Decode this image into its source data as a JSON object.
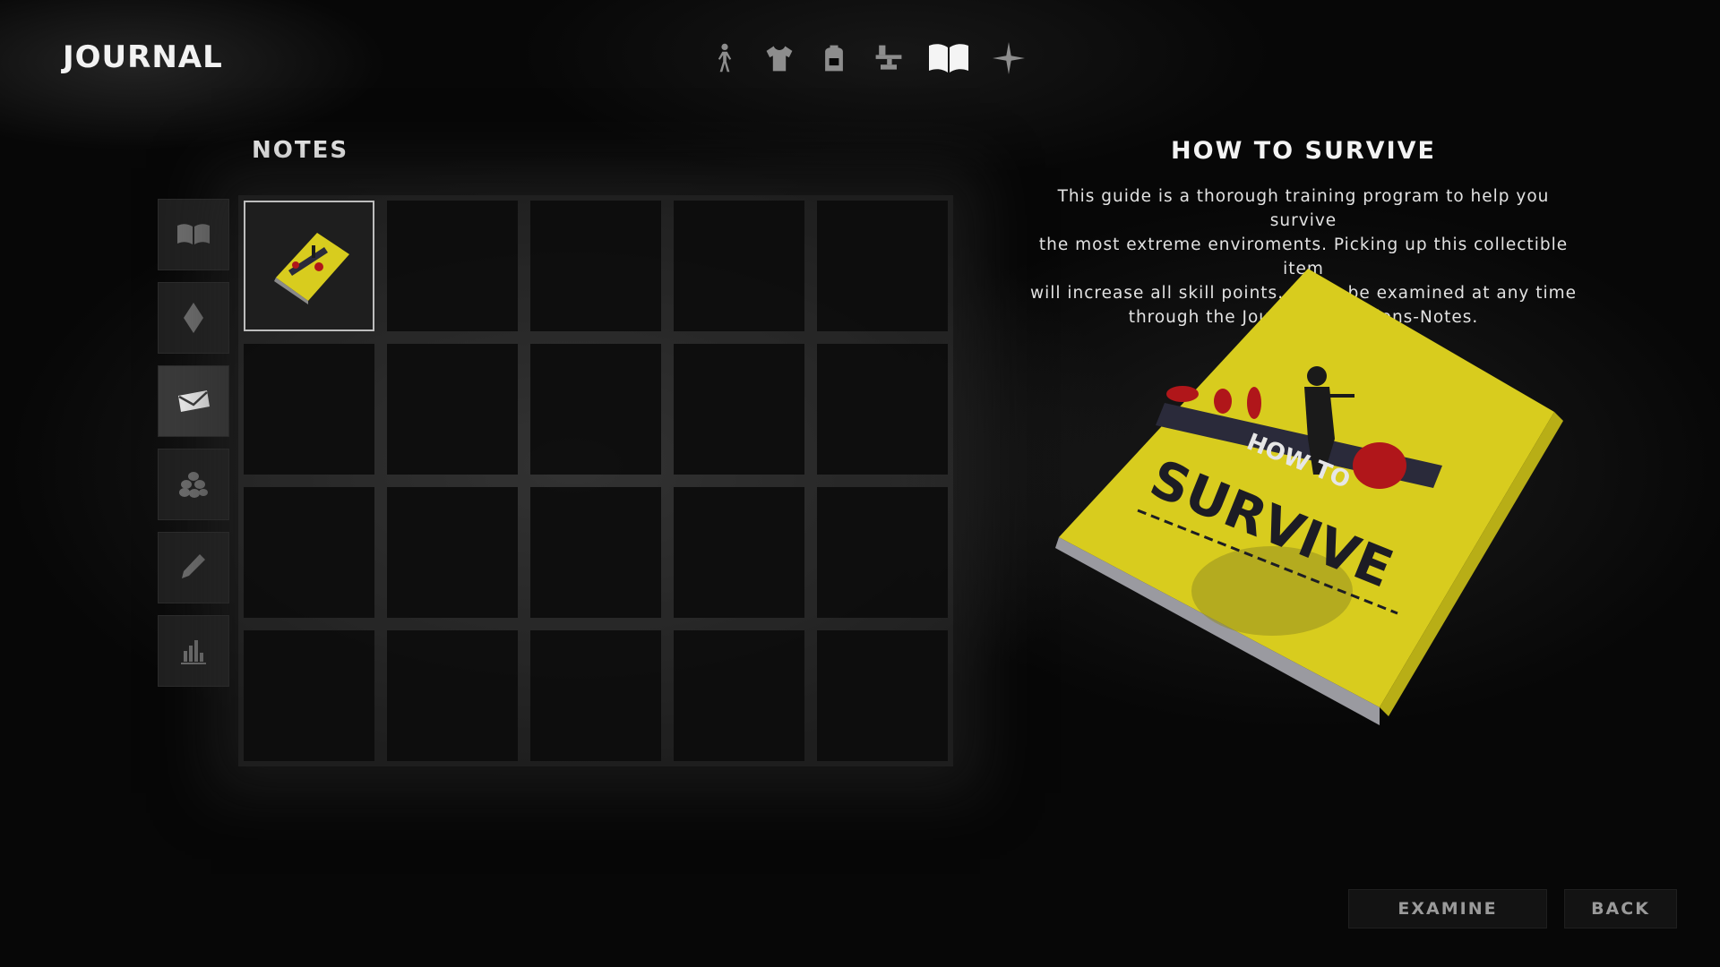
{
  "screen_title": "JOURNAL",
  "top_nav": [
    {
      "icon": "character-icon",
      "active": false
    },
    {
      "icon": "clothing-icon",
      "active": false
    },
    {
      "icon": "backpack-icon",
      "active": false
    },
    {
      "icon": "crafting-icon",
      "active": false
    },
    {
      "icon": "journal-icon",
      "active": true
    },
    {
      "icon": "map-star-icon",
      "active": false
    }
  ],
  "section_title": "NOTES",
  "categories": [
    {
      "icon": "book-icon",
      "active": false
    },
    {
      "icon": "diamond-icon",
      "active": false
    },
    {
      "icon": "envelope-icon",
      "active": true
    },
    {
      "icon": "stones-icon",
      "active": false
    },
    {
      "icon": "pencil-icon",
      "active": false
    },
    {
      "icon": "stats-icon",
      "active": false
    }
  ],
  "grid": {
    "columns": 5,
    "rows": 4,
    "filled": [
      {
        "slot": 0,
        "item": "How to Survive book",
        "selected": true
      }
    ]
  },
  "detail": {
    "title": "HOW TO SURVIVE",
    "description_lines": [
      "This guide is a thorough training program to help you survive",
      "the most extreme enviroments. Picking up this collectible item",
      "will increase all skill points. It can be examined at any time",
      "through the Journal-Collections-Notes."
    ],
    "book_cover": {
      "line1": "HOW TO",
      "line2": "SURVIVE"
    }
  },
  "buttons": {
    "examine": "EXAMINE",
    "back": "BACK"
  },
  "colors": {
    "book_yellow": "#d8cc1e",
    "book_red": "#b0161a",
    "book_dark": "#2a2a3a"
  }
}
